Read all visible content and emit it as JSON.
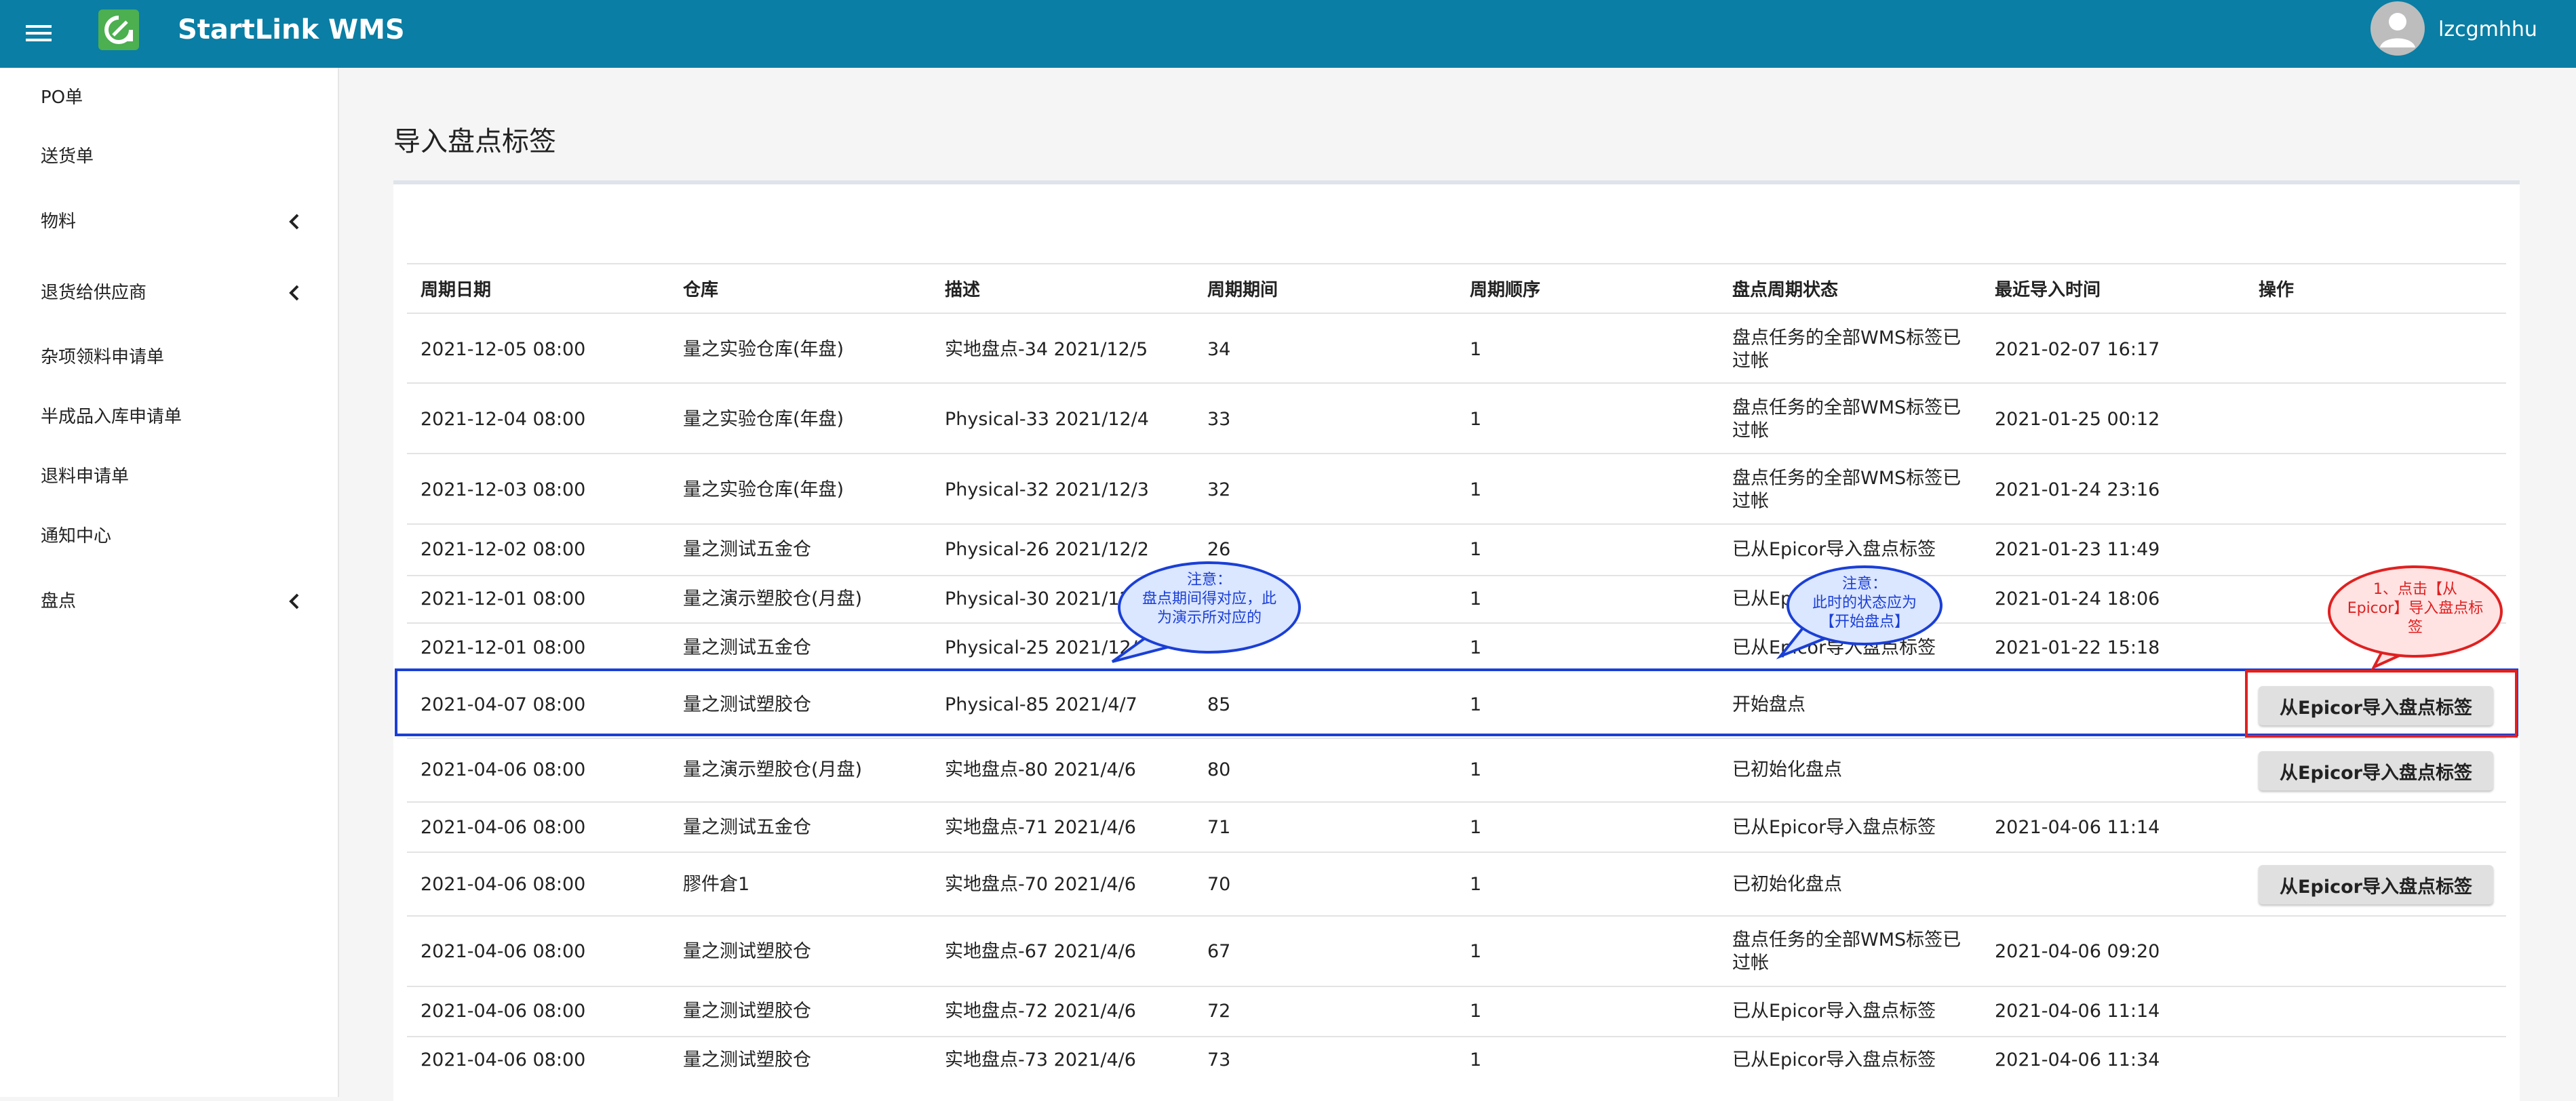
{
  "app": {
    "title": "StartLink WMS",
    "username": "lzcgmhhu"
  },
  "sidebar": {
    "items": [
      {
        "label": "PO单"
      },
      {
        "label": "送货单"
      },
      {
        "label": "物料"
      },
      {
        "label": "退货给供应商"
      },
      {
        "label": "杂项领料申请单"
      },
      {
        "label": "半成品入库申请单"
      },
      {
        "label": "退料申请单"
      },
      {
        "label": "通知中心"
      },
      {
        "label": "盘点"
      }
    ]
  },
  "page": {
    "title": "导入盘点标签"
  },
  "table": {
    "headers": [
      "周期日期",
      "仓库",
      "描述",
      "周期期间",
      "周期顺序",
      "盘点周期状态",
      "最近导入时间",
      "操作"
    ],
    "rows": [
      [
        "2021-12-05 08:00",
        "量之实验仓库(年盘)",
        "实地盘点-34 2021/12/5",
        "34",
        "1",
        "盘点任务的全部WMS标签已过帐",
        "2021-02-07 16:17"
      ],
      [
        "2021-12-04 08:00",
        "量之实验仓库(年盘)",
        "Physical-33 2021/12/4",
        "33",
        "1",
        "盘点任务的全部WMS标签已过帐",
        "2021-01-25 00:12"
      ],
      [
        "2021-12-03 08:00",
        "量之实验仓库(年盘)",
        "Physical-32 2021/12/3",
        "32",
        "1",
        "盘点任务的全部WMS标签已过帐",
        "2021-01-24 23:16"
      ],
      [
        "2021-12-02 08:00",
        "量之测试五金仓",
        "Physical-26 2021/12/2",
        "26",
        "1",
        "已从Epicor导入盘点标签",
        "2021-01-23 11:49"
      ],
      [
        "2021-12-01 08:00",
        "量之演示塑胶仓(月盘)",
        "Physical-30 2021/12/1",
        "",
        "1",
        "已从Epicor导入盘点标签",
        "2021-01-24 18:06"
      ],
      [
        "2021-12-01 08:00",
        "量之测试五金仓",
        "Physical-25 2021/12/1",
        "",
        "1",
        "已从Epicor导入盘点标签",
        "2021-01-22 15:18"
      ],
      [
        "2021-04-07 08:00",
        "量之测试塑胶仓",
        "Physical-85 2021/4/7",
        "85",
        "1",
        "开始盘点",
        ""
      ],
      [
        "2021-04-06 08:00",
        "量之演示塑胶仓(月盘)",
        "实地盘点-80 2021/4/6",
        "80",
        "1",
        "已初始化盘点",
        ""
      ],
      [
        "2021-04-06 08:00",
        "量之测试五金仓",
        "实地盘点-71 2021/4/6",
        "71",
        "1",
        "已从Epicor导入盘点标签",
        "2021-04-06 11:14"
      ],
      [
        "2021-04-06 08:00",
        "膠件倉1",
        "实地盘点-70 2021/4/6",
        "70",
        "1",
        "已初始化盘点",
        ""
      ],
      [
        "2021-04-06 08:00",
        "量之测试塑胶仓",
        "实地盘点-67 2021/4/6",
        "67",
        "1",
        "盘点任务的全部WMS标签已过帐",
        "2021-04-06 09:20"
      ],
      [
        "2021-04-06 08:00",
        "量之测试塑胶仓",
        "实地盘点-72 2021/4/6",
        "72",
        "1",
        "已从Epicor导入盘点标签",
        "2021-04-06 11:14"
      ],
      [
        "2021-04-06 08:00",
        "量之测试塑胶仓",
        "实地盘点-73 2021/4/6",
        "73",
        "1",
        "已从Epicor导入盘点标签",
        "2021-04-06 11:34"
      ]
    ],
    "action_label": "从Epicor导入盘点标签"
  },
  "annotations": {
    "note_period": {
      "title": "注意：",
      "text": "盘点期间得对应，此为演示所对应的"
    },
    "note_status": {
      "title": "注意：",
      "lines": [
        "此时的状态应为",
        "【开始盘点】"
      ]
    },
    "note_click": {
      "lines": [
        "1、点击【从",
        "Epicor】导入盘点标",
        "签"
      ]
    }
  },
  "colors": {
    "topbar": "#0a7ea4",
    "highlight_blue": "#1a3fd6",
    "highlight_red": "#e02020"
  }
}
